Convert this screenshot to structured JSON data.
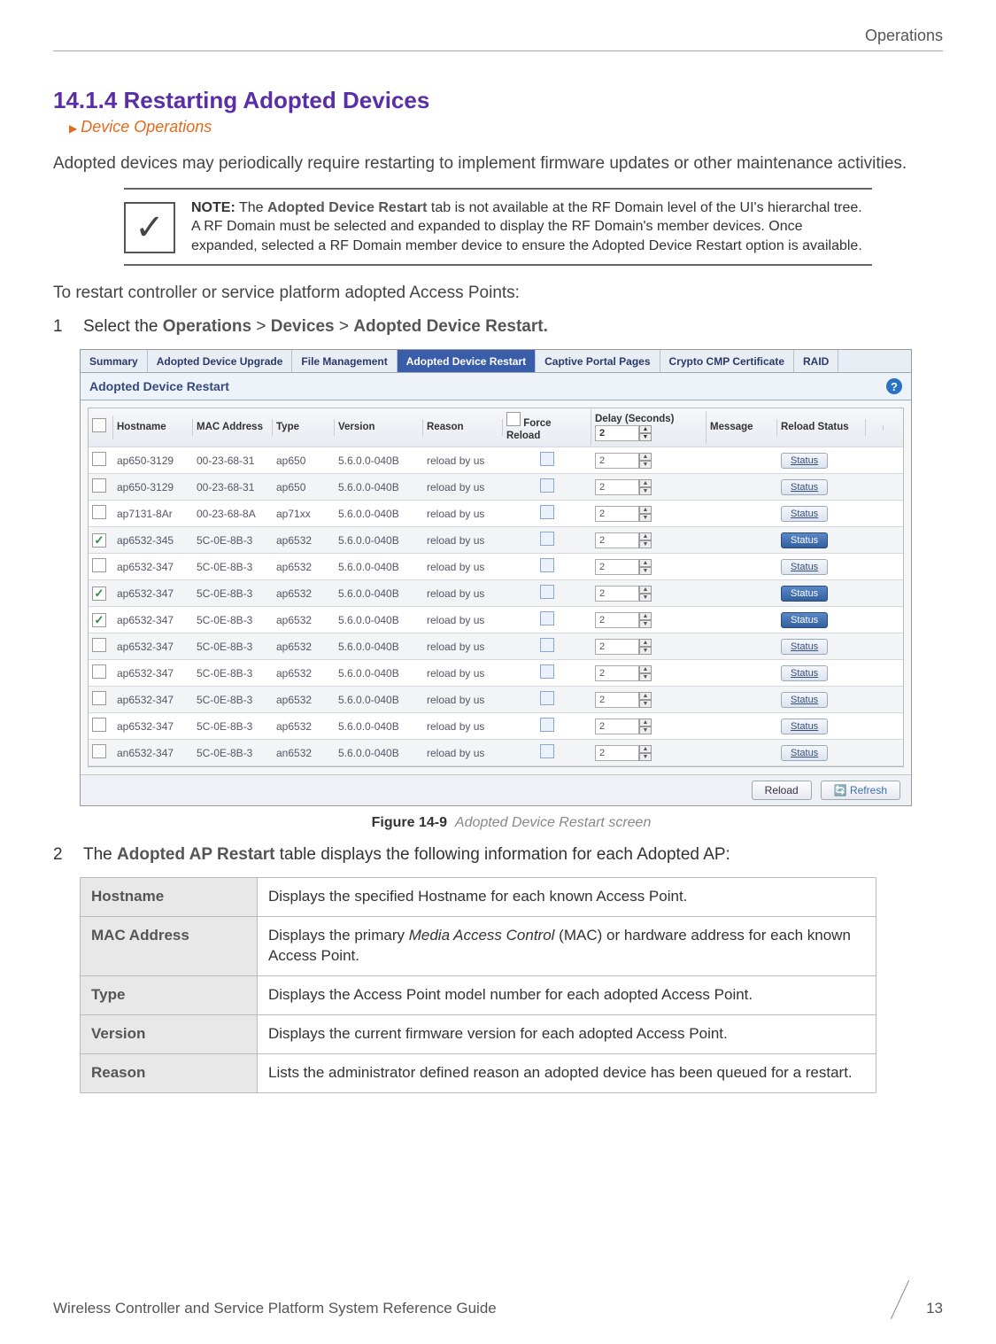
{
  "header": {
    "category": "Operations"
  },
  "section": {
    "number_title": "14.1.4 Restarting Adopted Devices",
    "breadcrumb": "Device Operations",
    "intro": "Adopted devices may periodically require restarting to implement firmware updates or other maintenance activities."
  },
  "note": {
    "label": "NOTE:",
    "bold_term": "Adopted Device Restart",
    "text_after": " tab is not available at the RF Domain level of the UI's hierarchal tree. A RF Domain must be selected and expanded to display the RF Domain's member devices. Once expanded, selected a RF Domain member device to ensure the Adopted Device Restart option is available."
  },
  "pre_steps": "To restart controller or service platform adopted Access Points:",
  "steps": {
    "s1": {
      "num": "1",
      "prefix": "Select the ",
      "p1": "Operations",
      "p2": "Devices",
      "p3": "Adopted Device Restart."
    },
    "s2": {
      "num": "2",
      "prefix": "The ",
      "bold": "Adopted AP Restart",
      "suffix": " table displays the following information for each Adopted AP:"
    }
  },
  "ui": {
    "tabs": [
      "Summary",
      "Adopted Device Upgrade",
      "File Management",
      "Adopted Device Restart",
      "Captive Portal Pages",
      "Crypto CMP Certificate",
      "RAID"
    ],
    "active_tab_index": 3,
    "panel_title": "Adopted Device Restart",
    "columns": {
      "hostname": "Hostname",
      "mac": "MAC Address",
      "type": "Type",
      "version": "Version",
      "reason": "Reason",
      "force": "Force Reload",
      "delay": "Delay (Seconds)",
      "message": "Message",
      "reload_status": "Reload Status"
    },
    "header_delay_val": "2",
    "rows": [
      {
        "chk": false,
        "host": "ap650-3129",
        "mac": "00-23-68-31",
        "type": "ap650",
        "ver": "5.6.0.0-040B",
        "reason": "reload by us",
        "delay": "2",
        "active": false
      },
      {
        "chk": false,
        "host": "ap650-3129",
        "mac": "00-23-68-31",
        "type": "ap650",
        "ver": "5.6.0.0-040B",
        "reason": "reload by us",
        "delay": "2",
        "active": false
      },
      {
        "chk": false,
        "host": "ap7131-8Ar",
        "mac": "00-23-68-8A",
        "type": "ap71xx",
        "ver": "5.6.0.0-040B",
        "reason": "reload by us",
        "delay": "2",
        "active": false
      },
      {
        "chk": true,
        "host": "ap6532-345",
        "mac": "5C-0E-8B-3",
        "type": "ap6532",
        "ver": "5.6.0.0-040B",
        "reason": "reload by us",
        "delay": "2",
        "active": true
      },
      {
        "chk": false,
        "host": "ap6532-347",
        "mac": "5C-0E-8B-3",
        "type": "ap6532",
        "ver": "5.6.0.0-040B",
        "reason": "reload by us",
        "delay": "2",
        "active": false
      },
      {
        "chk": true,
        "host": "ap6532-347",
        "mac": "5C-0E-8B-3",
        "type": "ap6532",
        "ver": "5.6.0.0-040B",
        "reason": "reload by us",
        "delay": "2",
        "active": true
      },
      {
        "chk": true,
        "host": "ap6532-347",
        "mac": "5C-0E-8B-3",
        "type": "ap6532",
        "ver": "5.6.0.0-040B",
        "reason": "reload by us",
        "delay": "2",
        "active": true
      },
      {
        "chk": false,
        "host": "ap6532-347",
        "mac": "5C-0E-8B-3",
        "type": "ap6532",
        "ver": "5.6.0.0-040B",
        "reason": "reload by us",
        "delay": "2",
        "active": false
      },
      {
        "chk": false,
        "host": "ap6532-347",
        "mac": "5C-0E-8B-3",
        "type": "ap6532",
        "ver": "5.6.0.0-040B",
        "reason": "reload by us",
        "delay": "2",
        "active": false
      },
      {
        "chk": false,
        "host": "ap6532-347",
        "mac": "5C-0E-8B-3",
        "type": "ap6532",
        "ver": "5.6.0.0-040B",
        "reason": "reload by us",
        "delay": "2",
        "active": false
      },
      {
        "chk": false,
        "host": "ap6532-347",
        "mac": "5C-0E-8B-3",
        "type": "ap6532",
        "ver": "5.6.0.0-040B",
        "reason": "reload by us",
        "delay": "2",
        "active": false
      },
      {
        "chk": false,
        "host": "an6532-347",
        "mac": "5C-0E-8B-3",
        "type": "an6532",
        "ver": "5.6.0.0-040B",
        "reason": "reload by us",
        "delay": "2",
        "active": false
      }
    ],
    "status_label": "Status",
    "footer": {
      "reload": "Reload",
      "refresh": "Refresh"
    }
  },
  "figure": {
    "label": "Figure 14-9",
    "caption": "Adopted Device Restart screen"
  },
  "desc_table": [
    {
      "k": "Hostname",
      "v": "Displays the specified Hostname for each known Access Point."
    },
    {
      "k": "MAC Address",
      "v": "Displays the primary Media Access Control (MAC) or hardware address for each known Access Point."
    },
    {
      "k": "Type",
      "v": "Displays the Access Point model number for each adopted Access Point."
    },
    {
      "k": "Version",
      "v": "Displays the current firmware version for each adopted Access Point."
    },
    {
      "k": "Reason",
      "v": "Lists the administrator defined reason an adopted device has been queued for a restart."
    }
  ],
  "footer": {
    "guide": "Wireless Controller and Service Platform System Reference Guide",
    "page": "13"
  }
}
